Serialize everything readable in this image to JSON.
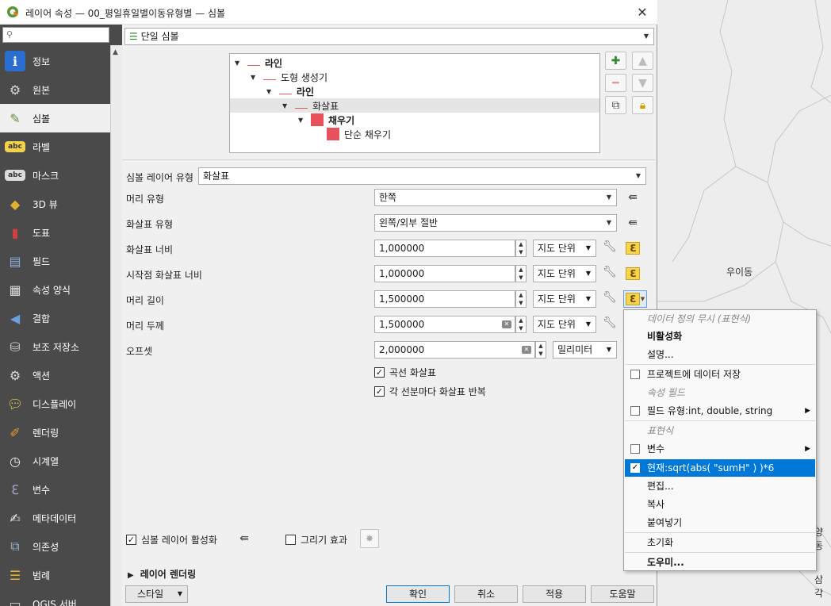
{
  "window": {
    "title": "레이어 속성 — 00_평일휴일별이동유형별 — 심볼",
    "close": "✕"
  },
  "search": {
    "placeholder": ""
  },
  "sidebar": {
    "items": [
      {
        "label": "정보",
        "icon": "info-icon"
      },
      {
        "label": "원본",
        "icon": "source-icon"
      },
      {
        "label": "심볼",
        "icon": "symbology-icon"
      },
      {
        "label": "라벨",
        "icon": "labels-icon"
      },
      {
        "label": "마스크",
        "icon": "mask-icon"
      },
      {
        "label": "3D 뷰",
        "icon": "3d-view-icon"
      },
      {
        "label": "도표",
        "icon": "diagrams-icon"
      },
      {
        "label": "필드",
        "icon": "fields-icon"
      },
      {
        "label": "속성 양식",
        "icon": "attributes-form-icon"
      },
      {
        "label": "결합",
        "icon": "joins-icon"
      },
      {
        "label": "보조 저장소",
        "icon": "auxiliary-storage-icon"
      },
      {
        "label": "액션",
        "icon": "actions-icon"
      },
      {
        "label": "디스플레이",
        "icon": "display-icon"
      },
      {
        "label": "렌더링",
        "icon": "rendering-icon"
      },
      {
        "label": "시계열",
        "icon": "temporal-icon"
      },
      {
        "label": "변수",
        "icon": "variables-icon"
      },
      {
        "label": "메타데이터",
        "icon": "metadata-icon"
      },
      {
        "label": "의존성",
        "icon": "dependencies-icon"
      },
      {
        "label": "범례",
        "icon": "legend-icon"
      },
      {
        "label": "QGIS 서버",
        "icon": "qgis-server-icon"
      }
    ],
    "active": "심볼"
  },
  "renderer": {
    "label": "단일 심볼"
  },
  "tree": {
    "rows": [
      "라인",
      "도형 생성기",
      "라인",
      "화살표",
      "채우기",
      "단순 채우기"
    ]
  },
  "symbol_layer_type": {
    "label": "심볼 레이어 유형",
    "value": "화살표"
  },
  "props": {
    "head_type": {
      "label": "머리 유형",
      "value": "한쪽"
    },
    "arrow_type": {
      "label": "화살표 유형",
      "value": "왼쪽/외부 절반"
    },
    "arrow_width": {
      "label": "화살표 너비",
      "value": "1,000000",
      "unit": "지도 단위"
    },
    "start_width": {
      "label": "시작점 화살표 너비",
      "value": "1,000000",
      "unit": "지도 단위"
    },
    "head_length": {
      "label": "머리 길이",
      "value": "1,500000",
      "unit": "지도 단위"
    },
    "head_thickness": {
      "label": "머리 두께",
      "value": "1,500000",
      "unit": "지도 단위"
    },
    "offset": {
      "label": "오프셋",
      "value": "2,000000",
      "unit": "밀리미터"
    }
  },
  "checks": {
    "curved": {
      "label": "곡선 화살표",
      "checked": true
    },
    "repeat": {
      "label": "각 선분마다 화살표 반복",
      "checked": true
    },
    "enable_layer": {
      "label": "심볼 레이어 활성화",
      "checked": true
    },
    "draw_effects": {
      "label": "그리기 효과",
      "checked": false
    }
  },
  "layer_rendering": {
    "label": "레이어 렌더링"
  },
  "buttons": {
    "style": "스타일",
    "ok": "확인",
    "cancel": "취소",
    "apply": "적용",
    "help": "도움말"
  },
  "menu": {
    "header": "데이터 정의 무시 (표현식)",
    "disable": "비활성화",
    "description": "설명...",
    "store_project": "프로젝트에 데이터 저장",
    "attr_field_section": "속성 필드",
    "field_type": "필드 유형:int, double, string",
    "expression_section": "표현식",
    "variable": "변수",
    "current": "현재:sqrt(abs( \"sumH\" ) )*6",
    "edit": "편집...",
    "copy": "복사",
    "paste": "붙여넣기",
    "clear": "초기화",
    "assistant": "도우미..."
  },
  "map": {
    "labels": [
      "우이동",
      "양동",
      "삼각"
    ]
  },
  "colors": {
    "accent": "#0078d7",
    "fill": "#e8505b",
    "sidebar": "#4a4a4a"
  }
}
